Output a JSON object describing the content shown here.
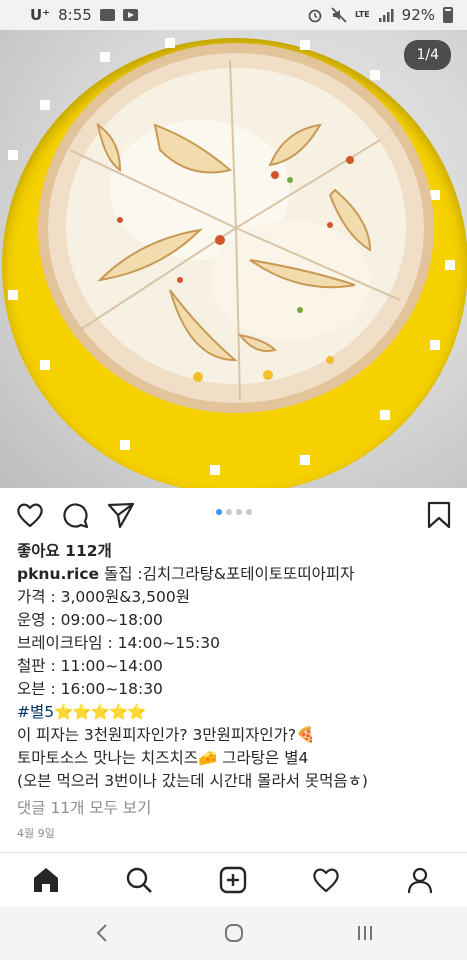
{
  "status_bar": {
    "carrier": "U⁺",
    "time": "8:55",
    "network": "LTE",
    "battery": "92%",
    "left_icons": [
      "image-icon",
      "youtube-icon"
    ],
    "right_icons": [
      "alarm-icon",
      "mute-icon",
      "signal-icon",
      "battery-icon"
    ]
  },
  "post": {
    "image_counter": "1/4",
    "carousel": {
      "total": 4,
      "active_index": 0
    },
    "likes": "좋아요 112개",
    "caption": {
      "username": "pknu.rice",
      "first_line": " 돌집 :김치그라탕&포테이토또띠아피자",
      "lines": [
        "가격 : 3,000원&3,500원",
        "운영 : 09:00~18:00",
        "브레이크타임 : 14:00~15:30",
        "철판 : 11:00~14:00",
        "오븐 : 16:00~18:30"
      ],
      "hashtag": "#별5",
      "stars": "⭐⭐⭐⭐⭐",
      "line_question": "이 피자는 3천원피자인가? 3만원피자인가?",
      "pizza_emoji": "🍕",
      "line_sauce_start": "토마토소스 맛나는 치즈치즈",
      "cheese_emoji": "🧀",
      "line_sauce_end": " 그라탕은 별4",
      "line_note": "(오븐 먹으러 3번이나 갔는데 시간대 몰라서 못먹음ㅎ)"
    },
    "comments_link": "댓글 11개 모두 보기",
    "date": "4월 9일"
  },
  "colors": {
    "plate": "#f6d100",
    "instagram_blue": "#3897f0",
    "hashtag": "#003569",
    "muted": "#8e8e8e"
  },
  "bottom_nav": [
    "home-icon",
    "search-icon",
    "add-post-icon",
    "heart-icon",
    "profile-icon"
  ],
  "system_nav": [
    "recent-apps-icon",
    "home-circle-icon",
    "back-icon"
  ]
}
